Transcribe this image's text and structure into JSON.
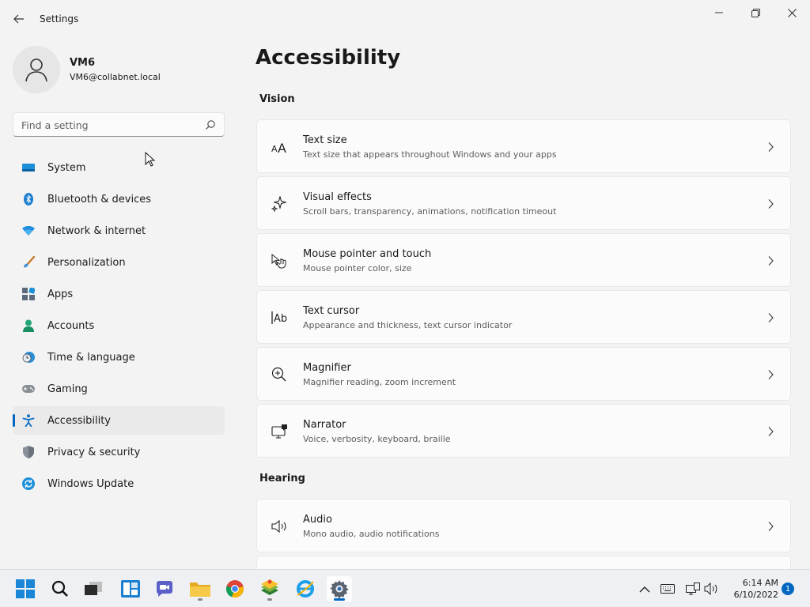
{
  "window": {
    "title": "Settings"
  },
  "profile": {
    "name": "VM6",
    "email": "VM6@collabnet.local"
  },
  "search": {
    "placeholder": "Find a setting"
  },
  "nav": {
    "items": [
      {
        "label": "System",
        "icon": "monitor-icon"
      },
      {
        "label": "Bluetooth & devices",
        "icon": "bluetooth-icon"
      },
      {
        "label": "Network & internet",
        "icon": "wifi-icon"
      },
      {
        "label": "Personalization",
        "icon": "brush-icon"
      },
      {
        "label": "Apps",
        "icon": "apps-icon"
      },
      {
        "label": "Accounts",
        "icon": "person-icon"
      },
      {
        "label": "Time & language",
        "icon": "clock-globe-icon"
      },
      {
        "label": "Gaming",
        "icon": "gamepad-icon"
      },
      {
        "label": "Accessibility",
        "icon": "accessibility-icon",
        "selected": true
      },
      {
        "label": "Privacy & security",
        "icon": "shield-icon"
      },
      {
        "label": "Windows Update",
        "icon": "update-icon"
      }
    ]
  },
  "main": {
    "title": "Accessibility",
    "sections": {
      "vision": {
        "title": "Vision",
        "cards": [
          {
            "title": "Text size",
            "desc": "Text size that appears throughout Windows and your apps",
            "icon": "text-size-icon"
          },
          {
            "title": "Visual effects",
            "desc": "Scroll bars, transparency, animations, notification timeout",
            "icon": "sparkle-icon"
          },
          {
            "title": "Mouse pointer and touch",
            "desc": "Mouse pointer color, size",
            "icon": "pointer-touch-icon"
          },
          {
            "title": "Text cursor",
            "desc": "Appearance and thickness, text cursor indicator",
            "icon": "text-cursor-icon"
          },
          {
            "title": "Magnifier",
            "desc": "Magnifier reading, zoom increment",
            "icon": "magnifier-icon"
          },
          {
            "title": "Narrator",
            "desc": "Voice, verbosity, keyboard, braille",
            "icon": "narrator-icon"
          }
        ]
      },
      "hearing": {
        "title": "Hearing",
        "cards": [
          {
            "title": "Audio",
            "desc": "Mono audio, audio notifications",
            "icon": "speaker-icon"
          }
        ]
      }
    }
  },
  "taskbar": {
    "apps": [
      "start",
      "search",
      "task-view",
      "widgets",
      "chat",
      "file-explorer",
      "chrome",
      "bluestacks",
      "internet-explorer",
      "settings"
    ],
    "clock": {
      "time": "6:14 AM",
      "date": "6/10/2022"
    },
    "notifications": "1"
  },
  "colors": {
    "accent": "#0067c0",
    "background": "#f3f3f3",
    "card": "#fbfbfb"
  }
}
